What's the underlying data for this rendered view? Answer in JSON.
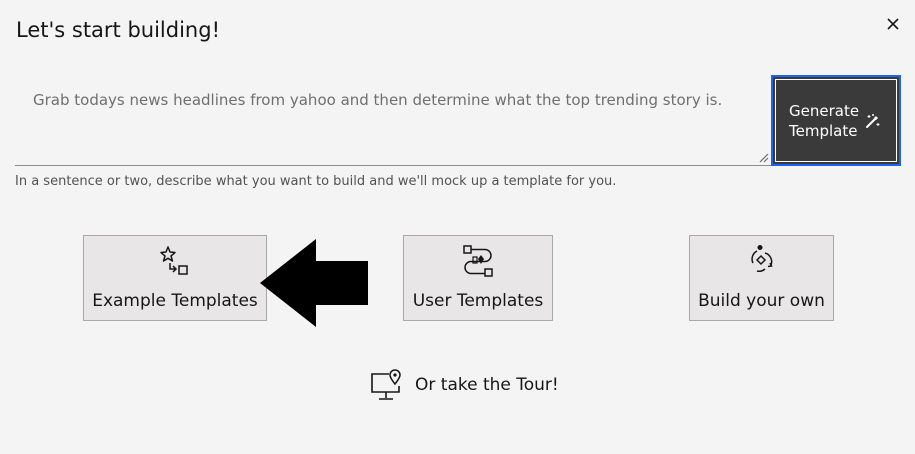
{
  "dialog": {
    "title": "Let's start building!",
    "close_icon": "close-icon"
  },
  "prompt": {
    "value": "Grab todays news headlines from yahoo and then determine what the top trending story is.",
    "helper_text": "In a sentence or two, describe what you want to build and we'll mock up a template for you."
  },
  "generate_button": {
    "label": "Generate Template",
    "icon": "magic-wand-icon",
    "background": "#3a3a3a",
    "focus_border": "#1b62f5"
  },
  "tiles": [
    {
      "label": "Example Templates",
      "icon": "star-shapes-icon"
    },
    {
      "label": "User Templates",
      "icon": "user-template-icon"
    },
    {
      "label": "Build your own",
      "icon": "build-flow-icon"
    }
  ],
  "tour": {
    "label": "Or take the Tour!",
    "icon": "monitor-location-icon"
  },
  "annotation": {
    "icon": "left-arrow-icon"
  }
}
